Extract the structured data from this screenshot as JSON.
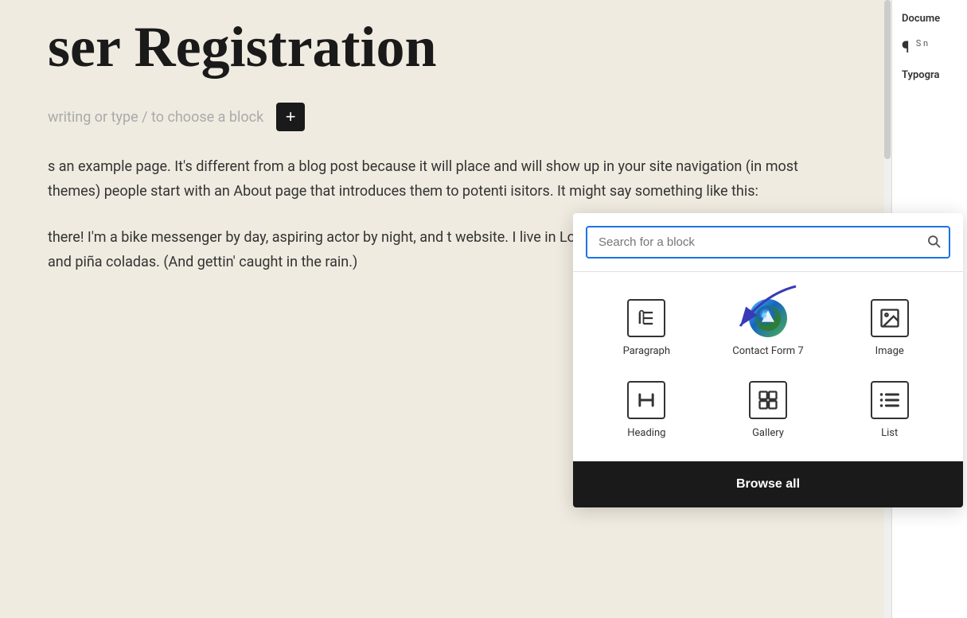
{
  "page": {
    "title": "ser Registration",
    "body_text_1": "s an example page. It's different from a blog post because it will place and will show up in your site navigation (in most themes) people start with an About page that introduces them to potenti isitors. It might say something like this:",
    "body_text_2": "there! I'm a bike messenger by day, aspiring actor by night, and t website. I live in Los Angeles, have a great dog named Jack, and piña coladas. (And gettin' caught in the rain.)",
    "placeholder_text": "writing or type / to choose a block"
  },
  "sidebar": {
    "title": "Docume",
    "paragraph_label": "P",
    "paragraph_desc": "S n",
    "typography_label": "Typogra"
  },
  "add_block": {
    "label": "+"
  },
  "block_inserter": {
    "search_placeholder": "Search for a block",
    "search_icon": "🔍",
    "blocks": [
      {
        "id": "paragraph",
        "label": "Paragraph",
        "type": "border"
      },
      {
        "id": "contact-form-7",
        "label": "Contact Form 7",
        "type": "round"
      },
      {
        "id": "image",
        "label": "Image",
        "type": "border"
      },
      {
        "id": "heading",
        "label": "Heading",
        "type": "border"
      },
      {
        "id": "gallery",
        "label": "Gallery",
        "type": "border"
      },
      {
        "id": "list",
        "label": "List",
        "type": "border"
      }
    ],
    "browse_all_label": "Browse all"
  },
  "colors": {
    "accent": "#1a73e8",
    "dark": "#1a1a1a",
    "arrow": "#3a3ab8"
  }
}
